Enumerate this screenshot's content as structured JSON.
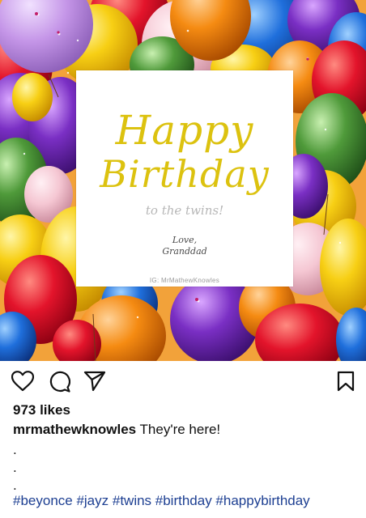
{
  "card": {
    "line1": "Happy",
    "line2": "Birthday",
    "subtitle": "to the twins!",
    "signoff_1": "Love,",
    "signoff_2": "Granddad",
    "watermark": "IG: MrMathewKnowles"
  },
  "post": {
    "likes": "973 likes",
    "username": "mrmathewknowles",
    "caption_text": " They're here!",
    "dot_lines": [
      ".",
      ".",
      "."
    ],
    "hashtags": "#beyonce #jayz #twins #birthday #happybirthday"
  },
  "icons": {
    "like": "heart-icon",
    "comment": "comment-icon",
    "share": "share-icon",
    "save": "bookmark-icon"
  },
  "colors": {
    "title_gold": "#dcc20f",
    "hashtag_blue": "#1d3f92"
  }
}
